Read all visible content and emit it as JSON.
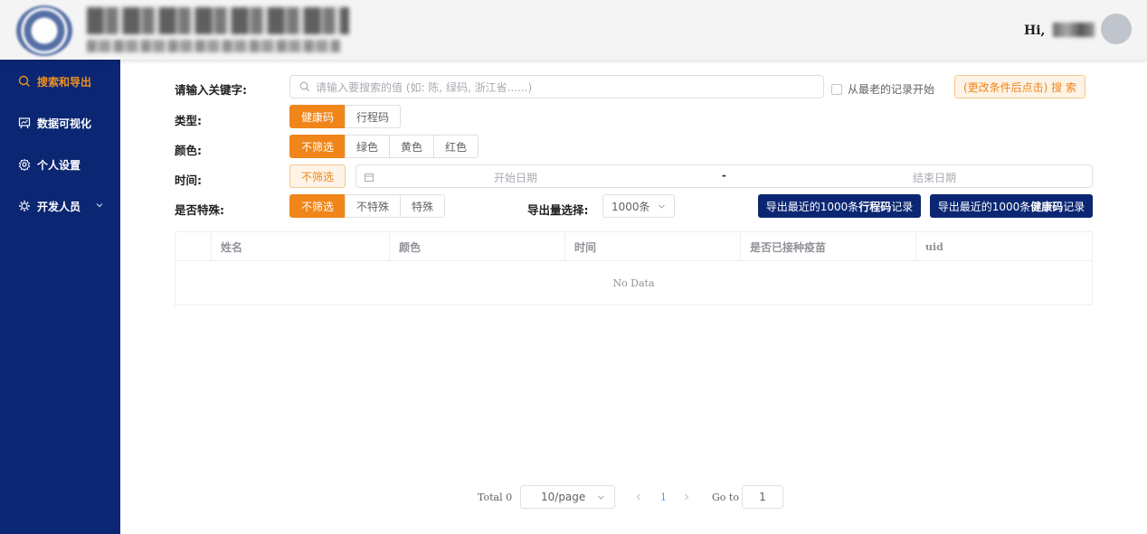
{
  "header": {
    "greeting": "Hi, "
  },
  "sidebar": {
    "items": [
      {
        "label": "搜索和导出",
        "icon": "search-icon",
        "active": true
      },
      {
        "label": "数据可视化",
        "icon": "chart-board-icon",
        "active": false
      },
      {
        "label": "个人设置",
        "icon": "gear-icon",
        "active": false
      },
      {
        "label": "开发人员",
        "icon": "cog-icon",
        "active": false
      }
    ]
  },
  "form": {
    "keyword_label": "请输入关键字:",
    "keyword_placeholder": "请输入要搜索的值 (如: 陈, 绿码, 浙江省......)",
    "oldest_first_label": "从最老的记录开始",
    "search_button": "(更改条件后点击) 搜 索",
    "type_label": "类型:",
    "type_options": [
      "健康码",
      "行程码"
    ],
    "color_label": "颜色:",
    "color_options": [
      "不筛选",
      "绿色",
      "黄色",
      "红色"
    ],
    "time_label": "时间:",
    "time_option": "不筛选",
    "start_date_placeholder": "开始日期",
    "date_separator": "-",
    "end_date_placeholder": "结束日期",
    "special_label": "是否特殊:",
    "special_options": [
      "不筛选",
      "不特殊",
      "特殊"
    ],
    "export_amount_label": "导出量选择:",
    "export_amount_value": "1000条",
    "export_trip": {
      "prefix": "导出最近的1000条",
      "bold": "行程码",
      "suffix": "记录"
    },
    "export_health": {
      "prefix": "导出最近的1000条",
      "bold": "健康码",
      "suffix": "记录"
    }
  },
  "table": {
    "columns": [
      "姓名",
      "颜色",
      "时间",
      "是否已接种疫苗",
      "uid"
    ],
    "empty_text": "No Data"
  },
  "pagination": {
    "total": "Total 0",
    "page_size": "10/page",
    "current_page": "1",
    "goto_label": "Go to",
    "goto_value": "1"
  },
  "colors": {
    "accent_orange": "#f0851a",
    "sidebar_navy": "#0b2773"
  }
}
